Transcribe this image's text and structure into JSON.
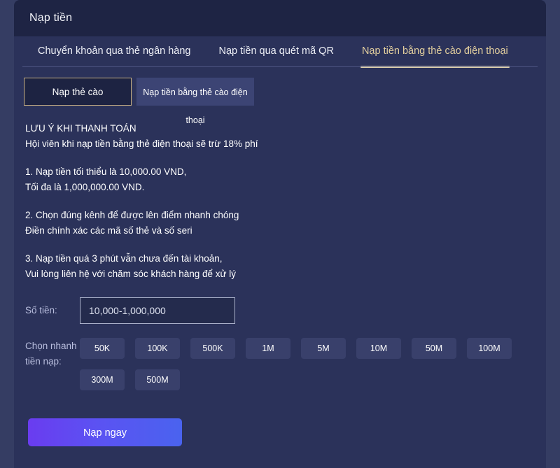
{
  "header": {
    "title": "Nạp tiền"
  },
  "tabs": [
    {
      "label": "Chuyển khoản qua thẻ ngân hàng",
      "active": false
    },
    {
      "label": "Nạp tiền qua quét mã QR",
      "active": false
    },
    {
      "label": "Nạp tiền bằng thẻ cào điện thoại",
      "active": true
    }
  ],
  "methods": [
    {
      "label": "Nạp thẻ cào",
      "selected": true
    },
    {
      "label": "Nạp tiền bằng thẻ cào điện thoại",
      "selected": false
    }
  ],
  "notice": {
    "heading": "LƯU Ý KHI THANH TOÁN",
    "subheading": "Hội viên khi nạp tiền bằng thẻ điện thoại sẽ trừ 18% phí",
    "items": [
      {
        "line1": "1. Nạp tiền tối thiểu là 10,000.00 VND,",
        "line2": "Tối đa là 1,000,000.00 VND."
      },
      {
        "line1": "2. Chọn đúng kênh để được lên điểm nhanh chóng",
        "line2": "Điền chính xác các mã số thẻ và số seri"
      },
      {
        "line1": "3. Nạp tiền quá 3 phút vẫn chưa đến tài khoản,",
        "line2": "Vui lòng liên hệ với chăm sóc khách hàng để xử lý"
      }
    ]
  },
  "form": {
    "amount_label": "Số tiền:",
    "amount_value": "",
    "amount_placeholder": "10,000-1,000,000",
    "quick_label": "Chọn nhanh tiền nạp:",
    "quick_amounts": [
      "50K",
      "100K",
      "500K",
      "1M",
      "5M",
      "10M",
      "50M",
      "100M",
      "300M",
      "500M"
    ],
    "submit_label": "Nạp ngay"
  },
  "colors": {
    "page_bg": "#353d63",
    "panel_bg": "#2b325a",
    "header_bg": "#1e2444",
    "accent_gold": "#e0d2ac",
    "label_text": "#b9bede",
    "quick_btn_bg": "#39406b",
    "submit_gradient_start": "#6a3cf0",
    "submit_gradient_end": "#4a63ef"
  }
}
